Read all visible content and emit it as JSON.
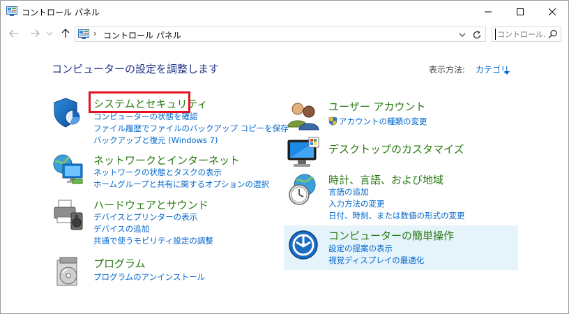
{
  "window": {
    "title": "コントロール パネル"
  },
  "address": {
    "crumb": "コントロール パネル",
    "separator": "›"
  },
  "search": {
    "placeholder": "コントロール..."
  },
  "main": {
    "heading": "コンピューターの設定を調整します",
    "view_by_label": "表示方法:",
    "view_by_value": "カテゴリ"
  },
  "categories_left": [
    {
      "title": "システムとセキュリティ",
      "icon": "shield-icon",
      "links": [
        "コンピューターの状態を確認",
        "ファイル履歴でファイルのバックアップ コピーを保存",
        "バックアップと復元 (Windows 7)"
      ]
    },
    {
      "title": "ネットワークとインターネット",
      "icon": "network-globe-icon",
      "links": [
        "ネットワークの状態とタスクの表示",
        "ホームグループと共有に関するオプションの選択"
      ]
    },
    {
      "title": "ハードウェアとサウンド",
      "icon": "printer-speaker-icon",
      "links": [
        "デバイスとプリンターの表示",
        "デバイスの追加",
        "共通で使うモビリティ設定の調整"
      ]
    },
    {
      "title": "プログラム",
      "icon": "programs-disc-icon",
      "links": [
        "プログラムのアンインストール"
      ]
    }
  ],
  "categories_right": [
    {
      "title": "ユーザー アカウント",
      "icon": "users-icon",
      "links": [
        "アカウントの種類の変更"
      ]
    },
    {
      "title": "デスクトップのカスタマイズ",
      "icon": "monitor-icon",
      "links": []
    },
    {
      "title": "時計、言語、および地域",
      "icon": "clock-globe-icon",
      "links": [
        "言語の追加",
        "入力方法の変更",
        "日付、時刻、または数値の形式の変更"
      ]
    },
    {
      "title": "コンピューターの簡単操作",
      "icon": "ease-of-access-icon",
      "links": [
        "設定の提案の表示",
        "視覚ディスプレイの最適化"
      ]
    }
  ],
  "colors": {
    "category_title": "#2a7a12",
    "link": "#0066cc",
    "heading": "#1e3287",
    "highlight": "#e81123",
    "hover": "#e5f3fb"
  }
}
